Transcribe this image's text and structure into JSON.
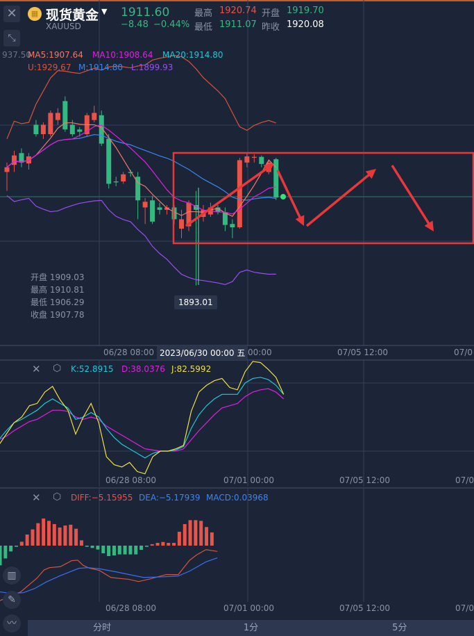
{
  "header": {
    "name": "现货黄金",
    "symbol": "XAUUSD",
    "price": "1911.60",
    "change": "−8.48",
    "change_pct": "−0.44%",
    "high_label": "最高",
    "high": "1920.74",
    "open_label": "开盘",
    "open": "1919.70",
    "low_label": "最低",
    "low": "1911.07",
    "prev_label": "昨收",
    "prev": "1920.08"
  },
  "colors": {
    "up": "#e8534a",
    "down": "#35b981",
    "ma5": "#f07a6a",
    "ma10": "#e020e0",
    "ma20": "#1ec8d8",
    "boll_u": "#d9533b",
    "boll_m": "#3a86f0",
    "boll_l": "#9a4ef0"
  },
  "main": {
    "axis_stub": "937.50",
    "ma5": "MA5:1907.64",
    "ma10": "MA10:1908.64",
    "ma20": "MA20:1914.80",
    "u": "U:1929.67",
    "m": "M:1914.80",
    "l": "L:1899.93",
    "info": [
      {
        "k": "开盘",
        "v": "1909.03"
      },
      {
        "k": "最高",
        "v": "1910.81"
      },
      {
        "k": "最低",
        "v": "1906.29"
      },
      {
        "k": "收盘",
        "v": "1907.78"
      }
    ],
    "low_marker": "1893.01",
    "time_labels": [
      "06/28 08:00",
      "07/05 12:00",
      "07/0"
    ],
    "crosshair_time": "2023/06/30 00:00 五",
    "crosshair_tail": "00:00"
  },
  "kdj": {
    "k": "K:52.8915",
    "d": "D:38.0376",
    "j": "J:82.5992",
    "time_labels": [
      "06/28 08:00",
      "07/01 00:00",
      "07/05 12:00",
      "07/0"
    ]
  },
  "macd": {
    "diff": "DIFF:−5.15955",
    "dea": "DEA:−5.17939",
    "macd": "MACD:0.03968",
    "time_labels": [
      "06/28 08:00",
      "07/01 00:00",
      "07/05 12:00",
      "07/0"
    ]
  },
  "tabs": [
    "分时",
    "1分",
    "5分"
  ],
  "chart_data": [
    {
      "type": "candlestick",
      "title": "现货黄金 XAUUSD",
      "candles": [
        [
          1917,
          1919,
          1913,
          1918
        ],
        [
          1918.5,
          1921.5,
          1917,
          1920.5
        ],
        [
          1921,
          1922,
          1918,
          1919
        ],
        [
          1918.8,
          1921,
          1917.5,
          1920.3
        ],
        [
          1927,
          1928,
          1924.5,
          1925
        ],
        [
          1925,
          1927.5,
          1924,
          1927
        ],
        [
          1925,
          1930,
          1924.5,
          1929.5
        ],
        [
          1928,
          1930.5,
          1927,
          1929.5
        ],
        [
          1932,
          1933,
          1925.5,
          1926
        ],
        [
          1927,
          1928,
          1924.5,
          1925
        ],
        [
          1926,
          1926.5,
          1924.5,
          1925.5
        ],
        [
          1925,
          1929.5,
          1924.5,
          1929
        ],
        [
          1928,
          1931,
          1927.5,
          1929.5
        ],
        [
          1929,
          1930,
          1922.5,
          1923
        ],
        [
          1924,
          1925,
          1913.5,
          1914.5
        ],
        [
          1915,
          1916,
          1914,
          1914.8
        ],
        [
          1915,
          1917,
          1914.5,
          1916.5
        ],
        [
          1917,
          1917.5,
          1916,
          1916.8
        ],
        [
          1916,
          1917,
          1907,
          1911
        ],
        [
          1909.5,
          1911.5,
          1906,
          1910.7
        ],
        [
          1911,
          1912,
          1906,
          1906.5
        ],
        [
          1909.5,
          1910.5,
          1908,
          1909
        ],
        [
          1909,
          1910,
          1908,
          1909.5
        ],
        [
          1909.5,
          1910,
          1906,
          1907
        ],
        [
          1905,
          1909,
          1903,
          1907
        ],
        [
          1905.5,
          1911,
          1904.5,
          1910.5
        ],
        [
          1910,
          1913,
          1893.01,
          1909
        ],
        [
          1907.5,
          1910,
          1906.5,
          1909
        ],
        [
          1908,
          1910.5,
          1907.5,
          1909.5
        ],
        [
          1909.5,
          1910,
          1908,
          1908.5
        ],
        [
          1908.5,
          1909.5,
          1904.5,
          1905.8
        ],
        [
          1906,
          1907,
          1903,
          1905.3
        ],
        [
          1905.3,
          1920,
          1905,
          1919.5
        ],
        [
          1919,
          1921,
          1918,
          1920.3
        ],
        [
          1920,
          1920.74,
          1919,
          1920.2
        ],
        [
          1920.2,
          1920.5,
          1918,
          1918.7
        ],
        [
          1917,
          1919.5,
          1916.5,
          1919
        ],
        [
          1919.7,
          1920,
          1911.07,
          1911.6
        ]
      ]
    },
    {
      "type": "line",
      "name": "KDJ",
      "K": [
        30,
        38,
        45,
        48,
        52,
        56,
        62,
        66,
        62,
        58,
        48,
        50,
        54,
        50,
        40,
        32,
        26,
        22,
        18,
        14,
        18,
        20,
        20,
        21,
        24,
        40,
        52,
        60,
        66,
        70,
        70,
        70,
        80,
        84,
        85,
        83,
        78,
        70
      ],
      "D": [
        30,
        33,
        38,
        42,
        46,
        48,
        52,
        56,
        56,
        55,
        50,
        48,
        50,
        48,
        42,
        38,
        34,
        30,
        26,
        22,
        21,
        20,
        20,
        20,
        22,
        30,
        38,
        45,
        52,
        58,
        60,
        62,
        68,
        72,
        74,
        75,
        72,
        66
      ],
      "J": [
        25,
        35,
        45,
        50,
        60,
        62,
        72,
        77,
        65,
        56,
        35,
        50,
        62,
        45,
        15,
        8,
        6,
        10,
        2,
        0,
        15,
        20,
        20,
        22,
        25,
        55,
        72,
        78,
        82,
        84,
        76,
        74,
        90,
        99,
        98,
        92,
        85,
        70
      ]
    },
    {
      "type": "bar",
      "name": "MACD",
      "hist": [
        -17.7,
        -11.5,
        -5.2,
        -1,
        3.5,
        10,
        14.6,
        20.2,
        24.4,
        22.3,
        19.4,
        16.3,
        18.1,
        18.8,
        15.2,
        4.8,
        -1,
        -2.1,
        -3.5,
        -6.9,
        -9.4,
        -8.8,
        -7.9,
        -7.9,
        -7.9,
        -7.9,
        -3.8,
        -1,
        1.3,
        2.5,
        3.3,
        2.5,
        2.5,
        12.5,
        19.4,
        22.9,
        22.9,
        22.3,
        16.7,
        11.9
      ],
      "diff": [
        [
          0,
          -49.4
        ],
        [
          3.8,
          -41.6
        ],
        [
          6.8,
          -29.2
        ],
        [
          8.1,
          -21.9
        ],
        [
          9.1,
          -19.8
        ],
        [
          11.1,
          -18.9
        ],
        [
          13.2,
          -13.5
        ],
        [
          14.3,
          -13.1
        ],
        [
          15.3,
          -17.7
        ],
        [
          16.4,
          -20.2
        ],
        [
          18.3,
          -22.3
        ],
        [
          20.4,
          -28.6
        ],
        [
          22.6,
          -29.8
        ],
        [
          23.6,
          -30.2
        ],
        [
          25.5,
          -32.3
        ],
        [
          27.7,
          -29.8
        ],
        [
          30.6,
          -26
        ],
        [
          32.8,
          -26
        ],
        [
          34.9,
          -13.1
        ],
        [
          36.2,
          -8.3
        ],
        [
          37.9,
          -3.6
        ],
        [
          40,
          -5.2
        ]
      ],
      "dea": [
        [
          0,
          -41.6
        ],
        [
          2.1,
          -43
        ],
        [
          4.3,
          -42.3
        ],
        [
          6.4,
          -38.5
        ],
        [
          8.5,
          -32.7
        ],
        [
          11.1,
          -27
        ],
        [
          13.2,
          -22.9
        ],
        [
          14.5,
          -20.4
        ],
        [
          16.2,
          -19.8
        ],
        [
          18.3,
          -20.8
        ],
        [
          21.3,
          -23.5
        ],
        [
          23.8,
          -26
        ],
        [
          26.4,
          -28.6
        ],
        [
          29.8,
          -28.1
        ],
        [
          32.8,
          -27.3
        ],
        [
          34.9,
          -22.9
        ],
        [
          37.9,
          -14.6
        ],
        [
          40,
          -11
        ]
      ]
    }
  ]
}
